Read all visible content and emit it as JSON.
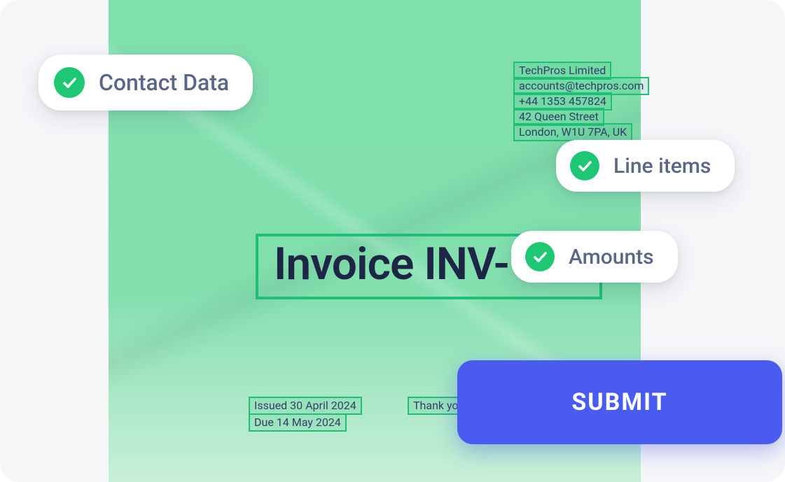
{
  "pills": {
    "contact": "Contact Data",
    "line_items": "Line items",
    "amounts": "Amounts"
  },
  "invoice": {
    "title": "Invoice INV-121",
    "contact": {
      "company": "TechPros Limited",
      "email": "accounts@techpros.com",
      "phone": "+44 1353 457824",
      "street": "42 Queen Street",
      "city": "London, W1U 7PA, UK"
    },
    "issued": "Issued 30 April 2024",
    "due": "Due 14 May 2024",
    "thanks": "Thank you for your business"
  },
  "submit_label": "SUBMIT"
}
